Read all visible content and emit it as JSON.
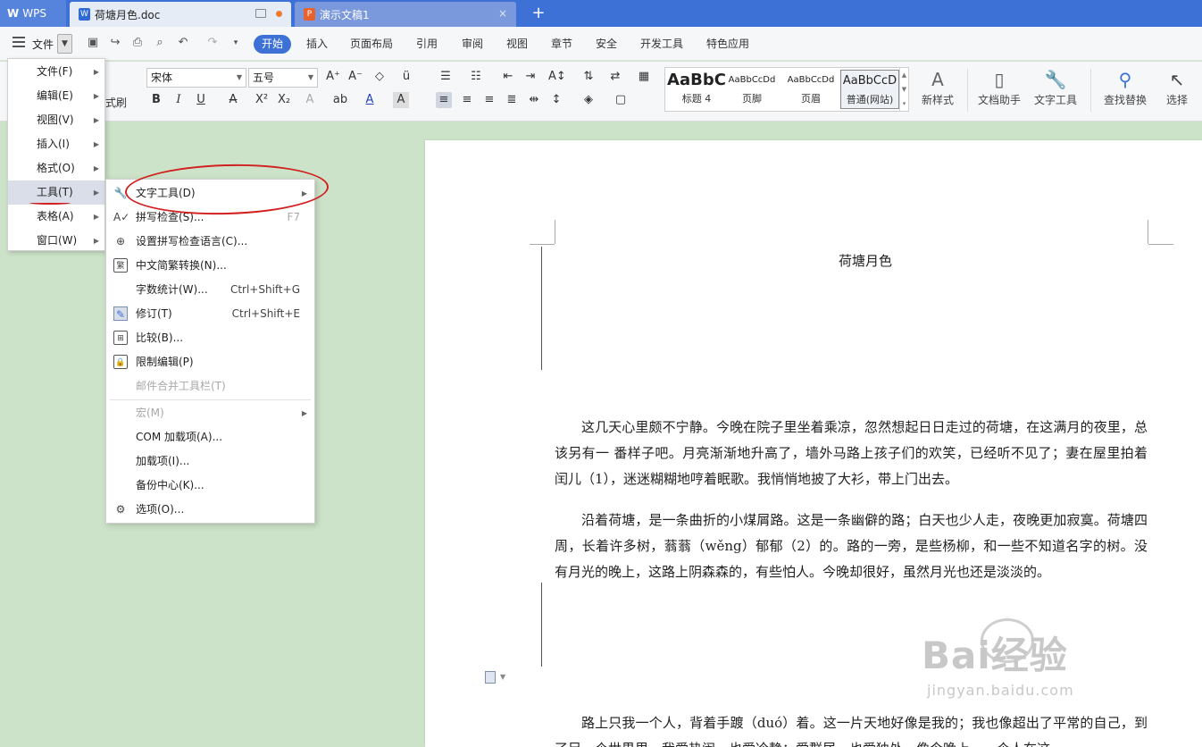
{
  "titlebar": {
    "app_label": "WPS",
    "doc_tab": "荷塘月色.doc",
    "ppt_tab": "演示文稿1",
    "close_glyph": "×",
    "new_tab_glyph": "+"
  },
  "menubar": {
    "file_label": "文件",
    "tabs": [
      "开始",
      "插入",
      "页面布局",
      "引用",
      "审阅",
      "视图",
      "章节",
      "安全",
      "开发工具",
      "特色应用"
    ],
    "active_tab": "开始"
  },
  "ribbon": {
    "format_painter": "式刷",
    "font_name": "宋体",
    "font_size": "五号",
    "styles": [
      {
        "preview": "AaBbC",
        "label": "标题 4"
      },
      {
        "preview": "AaBbCcDd",
        "label": "页脚"
      },
      {
        "preview": "AaBbCcDd",
        "label": "页眉"
      },
      {
        "preview": "AaBbCcD",
        "label": "普通(网站)"
      }
    ],
    "new_style": "新样式",
    "doc_assistant": "文档助手",
    "text_tools": "文字工具",
    "find_replace": "查找替换",
    "select": "选择"
  },
  "file_menu": {
    "items": [
      "文件(F)",
      "编辑(E)",
      "视图(V)",
      "插入(I)",
      "格式(O)",
      "工具(T)",
      "表格(A)",
      "窗口(W)"
    ],
    "highlighted": "工具(T)"
  },
  "tools_menu": {
    "items": [
      {
        "label": "文字工具(D)",
        "shortcut": "",
        "icon": "wrench-icon",
        "submenu": true,
        "disabled": false
      },
      {
        "label": "拼写检查(S)...",
        "shortcut": "F7",
        "icon": "spell-check-icon",
        "submenu": false,
        "disabled": false
      },
      {
        "label": "设置拼写检查语言(C)...",
        "shortcut": "",
        "icon": "globe-language-icon",
        "submenu": false,
        "disabled": false
      },
      {
        "label": "中文简繁转换(N)...",
        "shortcut": "",
        "icon": "convert-icon",
        "submenu": false,
        "disabled": false
      },
      {
        "label": "字数统计(W)...",
        "shortcut": "Ctrl+Shift+G",
        "icon": "",
        "submenu": false,
        "disabled": false
      },
      {
        "label": "修订(T)",
        "shortcut": "Ctrl+Shift+E",
        "icon": "track-changes-icon",
        "submenu": false,
        "disabled": false
      },
      {
        "label": "比较(B)...",
        "shortcut": "",
        "icon": "compare-icon",
        "submenu": false,
        "disabled": false
      },
      {
        "label": "限制编辑(P)",
        "shortcut": "",
        "icon": "restrict-edit-icon",
        "submenu": false,
        "disabled": false
      },
      {
        "label": "邮件合并工具栏(T)",
        "shortcut": "",
        "icon": "",
        "submenu": false,
        "disabled": true
      },
      {
        "label": "宏(M)",
        "shortcut": "",
        "icon": "",
        "submenu": true,
        "disabled": true
      },
      {
        "label": "COM 加载项(A)...",
        "shortcut": "",
        "icon": "",
        "submenu": false,
        "disabled": false
      },
      {
        "label": "加载项(I)...",
        "shortcut": "",
        "icon": "",
        "submenu": false,
        "disabled": false
      },
      {
        "label": "备份中心(K)...",
        "shortcut": "",
        "icon": "",
        "submenu": false,
        "disabled": false
      },
      {
        "label": "选项(O)...",
        "shortcut": "",
        "icon": "gear-icon",
        "submenu": false,
        "disabled": false
      }
    ]
  },
  "document": {
    "title": "荷塘月色",
    "paragraphs": [
      "这几天心里颇不宁静。今晚在院子里坐着乘凉，忽然想起日日走过的荷塘，在这满月的夜里，总该另有一 番样子吧。月亮渐渐地升高了，墙外马路上孩子们的欢笑，已经听不见了；妻在屋里拍着闰儿（1），迷迷糊糊地哼着眠歌。我悄悄地披了大衫，带上门出去。",
      "沿着荷塘，是一条曲折的小煤屑路。这是一条幽僻的路；白天也少人走，夜晚更加寂寞。荷塘四周，长着许多树，蓊蓊（wěng）郁郁（2）的。路的一旁，是些杨柳，和一些不知道名字的树。没有月光的晚上，这路上阴森森的，有些怕人。今晚却很好，虽然月光也还是淡淡的。",
      "路上只我一个人，背着手踱（duó）着。这一片天地好像是我的；我也像超出了平常的自己，到了另一个世界里。我爱热闹，也爱冷静；爱群居，也爱独处。像今晚上，一个人在这"
    ]
  },
  "watermark": {
    "main": "Bai经验",
    "sub": "jingyan.baidu.com"
  },
  "colors": {
    "accent": "#3d71d6",
    "annotation_red": "#d21f1f",
    "workspace_bg": "#cde3c9"
  }
}
